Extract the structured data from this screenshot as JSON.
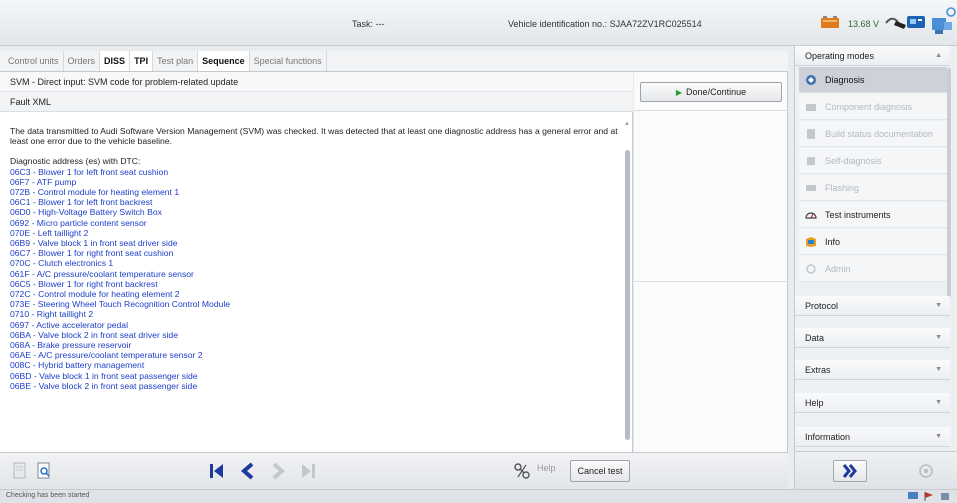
{
  "header": {
    "task_label": "Task:  ---",
    "vin_label": "Vehicle identification no.:  SJAA72ZV1RC025514",
    "voltage": "13.68 V"
  },
  "tabs": [
    {
      "label": "Control units",
      "state": "inactive"
    },
    {
      "label": "Orders",
      "state": "inactive"
    },
    {
      "label": "DISS",
      "state": "active"
    },
    {
      "label": "TPI",
      "state": "active"
    },
    {
      "label": "Test plan",
      "state": "inactive"
    },
    {
      "label": "Sequence",
      "state": "active"
    },
    {
      "label": "Special functions",
      "state": "inactive"
    }
  ],
  "step": {
    "title": "SVM - Direct input: SVM code for problem-related update",
    "subtitle": "Fault XML"
  },
  "message": {
    "intro": "The data transmitted to Audi Software Version Management (SVM) was checked. It was detected that at least one diagnostic address has a general error and at least one error due to the vehicle baseline.",
    "dtc_heading": "Diagnostic address (es) with DTC:",
    "dtc_list": [
      "06C3 - Blower 1 for left front seat cushion",
      "06F7 - ATF pump",
      "072B - Control module for heating element 1",
      "06C1 - Blower 1 for left front backrest",
      "06D0 - High-Voltage Battery Switch Box",
      "0692 - Micro particle content sensor",
      "070E - Left taillight 2",
      "06B9 - Valve block 1 in front seat driver side",
      "06C7 - Blower 1 for right front seat cushion",
      "070C - Clutch electronics 1",
      "061F - A/C pressure/coolant temperature sensor",
      "06C5 - Blower 1 for right front backrest",
      "072C - Control module for heating element 2",
      "073E - Steering Wheel Touch Recognition Control Module",
      "0710 - Right taillight 2",
      "0697 - Active accelerator pedal",
      "06BA - Valve block 2 in front seat driver side",
      "068A - Brake pressure reservoir",
      "06AE - A/C pressure/coolant temperature sensor 2",
      "008C - Hybrid battery management",
      "06BD - Valve block 1 in front seat passenger side",
      "06BE - Valve block 2 in front seat passenger side"
    ]
  },
  "actions": {
    "done_label": "Done/Continue",
    "help_label": "Help",
    "cancel_label": "Cancel test"
  },
  "right_panel": {
    "operating_modes_label": "Operating modes",
    "modes": [
      {
        "label": "Diagnosis",
        "state": "active",
        "icon": "diagnosis-icon"
      },
      {
        "label": "Component diagnosis",
        "state": "disabled",
        "icon": "component-icon"
      },
      {
        "label": "Build status documentation",
        "state": "disabled",
        "icon": "documentation-icon"
      },
      {
        "label": "Self-diagnosis",
        "state": "disabled",
        "icon": "self-diagnosis-icon"
      },
      {
        "label": "Flashing",
        "state": "disabled",
        "icon": "flashing-icon"
      },
      {
        "label": "Test instruments",
        "state": "enabled",
        "icon": "test-instruments-icon"
      },
      {
        "label": "Info",
        "state": "enabled",
        "icon": "info-icon"
      },
      {
        "label": "Admin",
        "state": "disabled",
        "icon": "admin-icon"
      }
    ],
    "sections": [
      "Protocol",
      "Data",
      "Extras",
      "Help",
      "Information"
    ]
  },
  "status": {
    "text": "Checking has been started"
  },
  "colors": {
    "link_blue": "#1d3ec9",
    "active_mode_bg": "#cdd2d8",
    "nav_blue": "#1f3a9e"
  }
}
